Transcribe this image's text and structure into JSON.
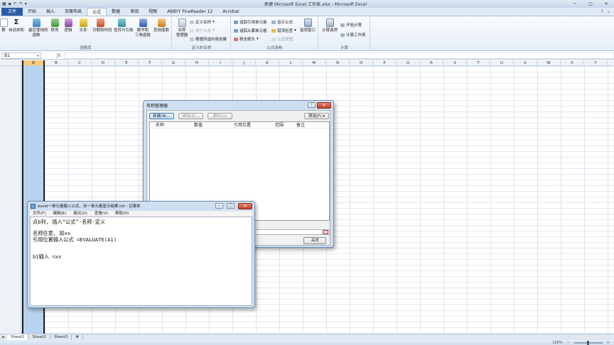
{
  "window": {
    "title": "新建 Microsoft Excel 工作表.xlsx - Microsoft Excel",
    "controls": [
      "─",
      "□",
      "✕"
    ]
  },
  "ribbon_tabs": [
    "文件",
    "开始",
    "插入",
    "页面布局",
    "公式",
    "数据",
    "审阅",
    "视图",
    "ABBYY FineReader 12",
    "Acrobat"
  ],
  "ribbon": {
    "function_library": {
      "label": "函数库",
      "buttons": [
        "数",
        "自动求和",
        "最近使用的\n函数",
        "财务",
        "逻辑",
        "文本",
        "日期和时间",
        "查找与引用",
        "数学和\n三角函数",
        "其他函数"
      ]
    },
    "defined_names": {
      "label": "定义的名称",
      "manager_label": "名称\n管理器",
      "define_name": "定义名称",
      "use_in_formula": "用于公式",
      "create_from_selection": "根据所选内容创建"
    },
    "formula_auditing": {
      "label": "公式审核",
      "trace_precedents": "追踪引用单元格",
      "trace_dependents": "追踪从属单元格",
      "remove_arrows": "移去箭头",
      "show_formulas": "显示公式",
      "error_checking": "错误检查",
      "evaluate_formula": "公式求值",
      "watch_window": "监视窗口"
    },
    "calculation": {
      "label": "计算",
      "options": "计算选项",
      "calc_now": "开始计算",
      "calc_sheet": "计算工作表"
    }
  },
  "formula_bar": {
    "name_box": "B1",
    "fx": "fx",
    "formula": ""
  },
  "columns": [
    "A",
    "B",
    "C",
    "D",
    "E",
    "F",
    "G",
    "H",
    "I",
    "J",
    "K",
    "L",
    "M",
    "N",
    "O",
    "P",
    "Q",
    "R",
    "S",
    "T",
    "U",
    "V",
    "W",
    "X",
    "Y"
  ],
  "sheets": [
    "Sheet1",
    "Sheet2",
    "Sheet3"
  ],
  "status": {
    "zoom": "100%"
  },
  "name_manager": {
    "title": "名称管理器",
    "new": "新建(N)...",
    "edit": "编辑(E)...",
    "delete": "删除(D)",
    "filter": "筛选(F) ▾",
    "headers": [
      "名称",
      "数值",
      "引用位置",
      "范围",
      "备注"
    ],
    "close": "关闭"
  },
  "notepad": {
    "title": "excel一单元格输入公式，另一单元格显示结果.txt - 记事本",
    "menus": [
      "文件(F)",
      "编辑(E)",
      "格式(O)",
      "查看(V)",
      "帮助(H)"
    ],
    "lines": [
      "点b列, 插入“公式”-名称-定义",
      "",
      "名称任意, 如xx",
      "引用位置输入公式 =EVALUATE(A1)",
      "",
      "",
      "b1输入 =xx"
    ]
  }
}
